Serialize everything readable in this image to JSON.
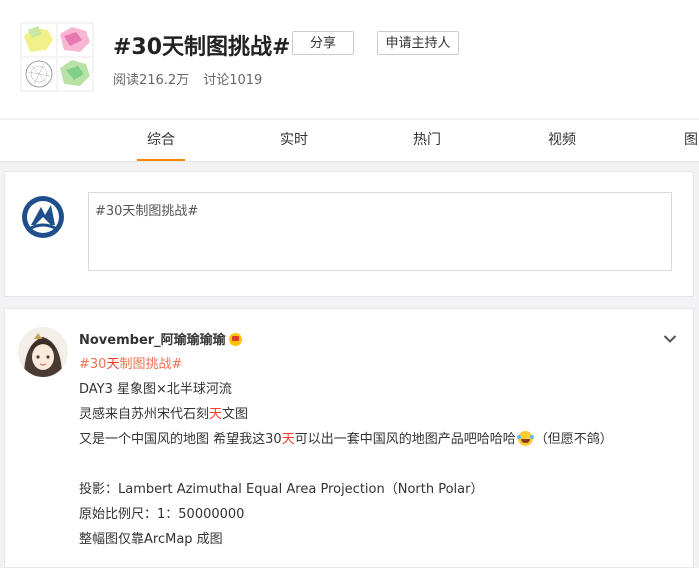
{
  "topic": {
    "title": "#30天制图挑战#",
    "share_label": "分享",
    "host_label": "申请主持人",
    "reads": "阅读216.2万",
    "discussions": "讨论1019"
  },
  "tabs": [
    {
      "label": "综合",
      "active": true
    },
    {
      "label": "实时",
      "active": false
    },
    {
      "label": "热门",
      "active": false
    },
    {
      "label": "视频",
      "active": false
    },
    {
      "label": "图片",
      "active": false
    }
  ],
  "compose": {
    "prefill": "#30天制图挑战#"
  },
  "post": {
    "username": "November_阿瑜瑜瑜瑜",
    "hashtag_prefix": "#30",
    "hashtag_highlight": "天",
    "hashtag_suffix": "制图挑战#",
    "line1": "DAY3 星象图×北半球河流",
    "line2_a": "灵感来自苏州宋代石刻",
    "line2_hl": "天",
    "line2_b": "文图",
    "line3_a": "又是一个中国风的地图 希望我这30",
    "line3_hl": "天",
    "line3_b": "可以出一套中国风的地图产品吧哈哈哈",
    "line3_c": "（但愿不鸽）",
    "line4": "投影：Lambert Azimuthal Equal Area Projection（North Polar）",
    "line5": "原始比例尺：1：50000000",
    "line6": "整幅图仅靠ArcMap 成图"
  },
  "colors": {
    "accent": "#ff8200",
    "hashtag": "#eb7350",
    "highlight": "#ff3b30"
  },
  "icons": {
    "cover": "topic-cover-image",
    "compose_avatar": "map-logo-icon",
    "post_avatar": "user-avatar",
    "vip_badge": "vip-crown-icon",
    "more": "chevron-down-icon",
    "emoji": "laugh-cry-emoji-icon"
  }
}
